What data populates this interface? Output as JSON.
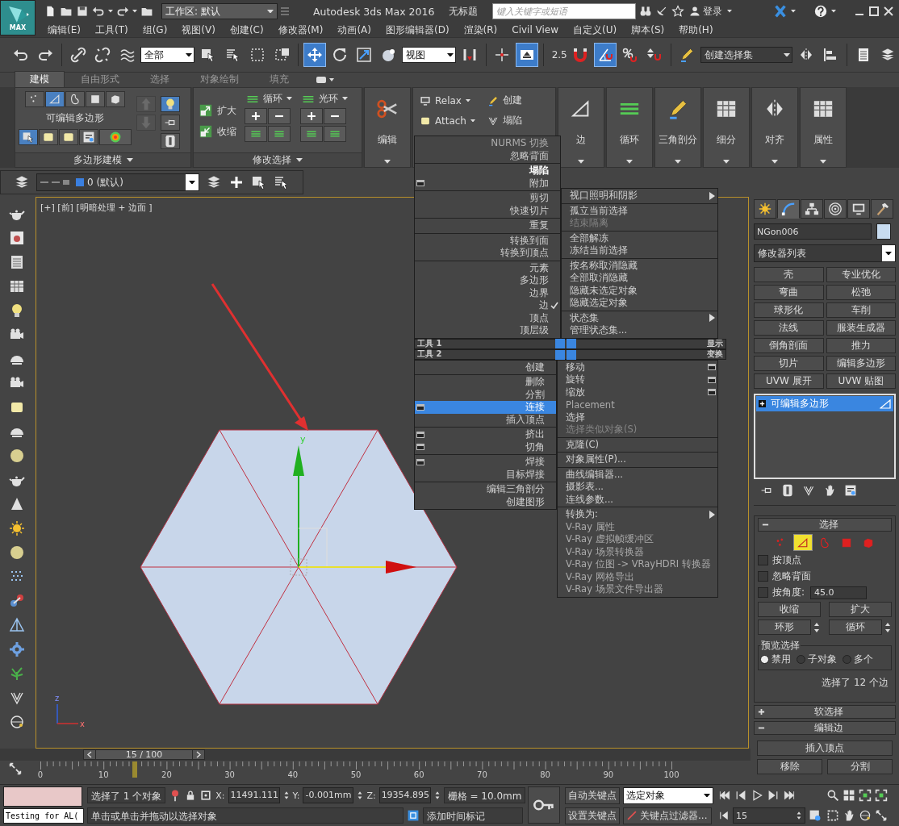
{
  "title_bar": {
    "logo": "MAX",
    "workspace": "工作区: 默认",
    "app_title": "Autodesk 3ds Max 2016",
    "document": "无标题",
    "search": {
      "placeholder": "键入关键字或短语"
    },
    "sign_in": "登录"
  },
  "menu_bar": [
    "编辑(E)",
    "工具(T)",
    "组(G)",
    "视图(V)",
    "创建(C)",
    "修改器(M)",
    "动画(A)",
    "图形编辑器(D)",
    "渲染(R)",
    "Civil View",
    "自定义(U)",
    "脚本(S)",
    "帮助(H)"
  ],
  "main_toolbar": {
    "selection_filter": "全部",
    "reference_coordinate": "视图",
    "snap_value": "2.5",
    "named_selection": "创建选择集",
    "tools": [
      {
        "selected": false
      },
      {
        "selected": false
      },
      {
        "selected": false
      },
      {
        "selected": false
      },
      {
        "selected": false
      },
      {
        "selected": false
      },
      {
        "selected": false
      },
      {
        "selected": false
      },
      {
        "selected": false
      },
      {
        "selected": true
      },
      {
        "selected": false
      },
      {
        "selected": false
      },
      {
        "selected": false
      },
      {
        "selected": false
      },
      {
        "selected": false
      },
      {
        "selected": true
      },
      {
        "selected": false
      },
      {
        "selected": true
      },
      {
        "selected": false
      },
      {
        "selected": false
      },
      {
        "selected": false
      },
      {
        "selected": false
      },
      {
        "selected": false
      },
      {
        "selected": false
      },
      {
        "selected": false
      }
    ]
  },
  "ribbon": {
    "tabs": [
      {
        "label": "建模",
        "selected": true
      },
      {
        "label": "自由形式",
        "selected": false
      },
      {
        "label": "选择",
        "selected": false
      },
      {
        "label": "对象绘制",
        "selected": false
      },
      {
        "label": "填充",
        "selected": false
      }
    ],
    "poly_modeling": {
      "title": "多边形建模",
      "object_type": "可编辑多边形",
      "levels": [
        {
          "selected": false
        },
        {
          "selected": true
        },
        {
          "selected": false
        },
        {
          "selected": false
        },
        {
          "selected": false
        }
      ]
    },
    "modify_selection": {
      "title": "修改选择",
      "grow": "扩大",
      "shrink": "收缩",
      "loop": "循环",
      "ring": "光环"
    },
    "edit": "编辑",
    "geometry": {
      "relax": "Relax",
      "attach": "Attach",
      "create": "创建",
      "collapse": "塌陷"
    },
    "big_buttons": [
      "边",
      "循环",
      "三角剖分",
      "细分",
      "对齐",
      "属性"
    ]
  },
  "layer_toolbar": {
    "layer": "0 (默认)"
  },
  "viewport": {
    "label": "[+] [前] [明暗处理 + 边面 ]",
    "gizmo_axis": "y",
    "tripod_axes": [
      "z",
      "x"
    ]
  },
  "quad_menu": {
    "top_left": {
      "groups": [
        [
          {
            "label": "NURMS 切换",
            "kind": "dim",
            "selected": false,
            "checked": false,
            "settings": false
          },
          {
            "label": "忽略背面",
            "kind": "normal",
            "selected": false,
            "checked": false,
            "settings": false
          }
        ],
        [
          {
            "label": "塌陷",
            "kind": "bright",
            "selected": false,
            "checked": false,
            "settings": false
          },
          {
            "label": "附加",
            "kind": "normal",
            "selected": false,
            "checked": false,
            "settings": true
          }
        ],
        [
          {
            "label": "剪切",
            "kind": "normal",
            "selected": false,
            "checked": false,
            "settings": false
          },
          {
            "label": "快速切片",
            "kind": "normal",
            "selected": false,
            "checked": false,
            "settings": false
          }
        ],
        [
          {
            "label": "重复",
            "kind": "normal",
            "selected": false,
            "checked": false,
            "settings": false
          }
        ],
        [
          {
            "label": "转换到面",
            "kind": "normal",
            "selected": false,
            "checked": false,
            "settings": false
          },
          {
            "label": "转换到顶点",
            "kind": "normal",
            "selected": false,
            "checked": false,
            "settings": false
          }
        ],
        [
          {
            "label": "元素",
            "kind": "normal",
            "selected": false,
            "checked": false,
            "settings": false
          },
          {
            "label": "多边形",
            "kind": "normal",
            "selected": false,
            "checked": false,
            "settings": false
          },
          {
            "label": "边界",
            "kind": "normal",
            "selected": false,
            "checked": false,
            "settings": false
          },
          {
            "label": "边",
            "kind": "normal",
            "selected": false,
            "checked": true,
            "settings": false
          },
          {
            "label": "顶点",
            "kind": "normal",
            "selected": false,
            "checked": false,
            "settings": false
          },
          {
            "label": "顶层级",
            "kind": "normal",
            "selected": false,
            "checked": false,
            "settings": false
          }
        ]
      ]
    },
    "top_right": {
      "groups": [
        [
          {
            "label": "视口照明和阴影",
            "kind": "normal",
            "selected": false,
            "settings": false,
            "submenu": true
          }
        ],
        [
          {
            "label": "孤立当前选择",
            "kind": "normal",
            "selected": false,
            "settings": false,
            "submenu": false
          },
          {
            "label": "结束隔离",
            "kind": "disabled",
            "selected": false,
            "settings": false,
            "submenu": false
          }
        ],
        [
          {
            "label": "全部解冻",
            "kind": "normal",
            "selected": false,
            "settings": false,
            "submenu": false
          },
          {
            "label": "冻结当前选择",
            "kind": "normal",
            "selected": false,
            "settings": false,
            "submenu": false
          }
        ],
        [
          {
            "label": "按名称取消隐藏",
            "kind": "normal",
            "selected": false,
            "settings": false,
            "submenu": false
          },
          {
            "label": "全部取消隐藏",
            "kind": "normal",
            "selected": false,
            "settings": false,
            "submenu": false
          },
          {
            "label": "隐藏未选定对象",
            "kind": "normal",
            "selected": false,
            "settings": false,
            "submenu": false
          },
          {
            "label": "隐藏选定对象",
            "kind": "normal",
            "selected": false,
            "settings": false,
            "submenu": false
          }
        ],
        [
          {
            "label": "状态集",
            "kind": "normal",
            "selected": false,
            "settings": false,
            "submenu": true
          },
          {
            "label": "管理状态集...",
            "kind": "normal",
            "selected": false,
            "settings": false,
            "submenu": false
          }
        ]
      ]
    },
    "headers": [
      {
        "left": "工具 1",
        "right": "显示"
      },
      {
        "left": "工具 2",
        "right": "变换"
      }
    ],
    "bottom_left": {
      "groups": [
        [
          {
            "label": "创建",
            "kind": "normal",
            "selected": false,
            "checked": false,
            "settings": false
          }
        ],
        [
          {
            "label": "删除",
            "kind": "normal",
            "selected": false,
            "checked": false,
            "settings": false
          },
          {
            "label": "分割",
            "kind": "normal",
            "selected": false,
            "checked": false,
            "settings": false
          },
          {
            "label": "连接",
            "kind": "normal",
            "selected": true,
            "checked": false,
            "settings": true
          },
          {
            "label": "插入顶点",
            "kind": "normal",
            "selected": false,
            "checked": false,
            "settings": false
          }
        ],
        [
          {
            "label": "挤出",
            "kind": "normal",
            "selected": false,
            "checked": false,
            "settings": true
          },
          {
            "label": "切角",
            "kind": "normal",
            "selected": false,
            "checked": false,
            "settings": true
          }
        ],
        [
          {
            "label": "焊接",
            "kind": "normal",
            "selected": false,
            "checked": false,
            "settings": true
          },
          {
            "label": "目标焊接",
            "kind": "normal",
            "selected": false,
            "checked": false,
            "settings": false
          }
        ],
        [
          {
            "label": "编辑三角剖分",
            "kind": "normal",
            "selected": false,
            "checked": false,
            "settings": false
          },
          {
            "label": "创建图形",
            "kind": "normal",
            "selected": false,
            "checked": false,
            "settings": false
          }
        ]
      ]
    },
    "bottom_right": {
      "groups": [
        [
          {
            "label": "移动",
            "kind": "normal",
            "selected": false,
            "settings": true,
            "submenu": false
          },
          {
            "label": "旋转",
            "kind": "normal",
            "selected": false,
            "settings": true,
            "submenu": false
          },
          {
            "label": "缩放",
            "kind": "normal",
            "selected": false,
            "settings": true,
            "submenu": false
          },
          {
            "label": "Placement",
            "kind": "dim",
            "selected": false,
            "settings": false,
            "submenu": false
          },
          {
            "label": "选择",
            "kind": "normal",
            "selected": false,
            "settings": false,
            "submenu": false
          },
          {
            "label": "选择类似对象(S)",
            "kind": "disabled",
            "selected": false,
            "settings": false,
            "submenu": false
          }
        ],
        [
          {
            "label": "克隆(C)",
            "kind": "normal",
            "selected": false,
            "settings": false,
            "submenu": false
          }
        ],
        [
          {
            "label": "对象属性(P)...",
            "kind": "normal",
            "selected": false,
            "settings": false,
            "submenu": false
          }
        ],
        [
          {
            "label": "曲线编辑器...",
            "kind": "normal",
            "selected": false,
            "settings": false,
            "submenu": false
          },
          {
            "label": "摄影表...",
            "kind": "normal",
            "selected": false,
            "settings": false,
            "submenu": false
          },
          {
            "label": "连线参数...",
            "kind": "normal",
            "selected": false,
            "settings": false,
            "submenu": false
          }
        ],
        [
          {
            "label": "转换为:",
            "kind": "normal",
            "selected": false,
            "settings": false,
            "submenu": true
          },
          {
            "label": "V-Ray 属性",
            "kind": "dim",
            "selected": false,
            "settings": false,
            "submenu": false
          },
          {
            "label": "V-Ray 虚拟帧缓冲区",
            "kind": "dim",
            "selected": false,
            "settings": false,
            "submenu": false
          },
          {
            "label": "V-Ray 场景转换器",
            "kind": "dim",
            "selected": false,
            "settings": false,
            "submenu": false
          },
          {
            "label": "V-Ray 位图 -> VRayHDRI 转换器",
            "kind": "dim",
            "selected": false,
            "settings": false,
            "submenu": false
          },
          {
            "label": "V-Ray 网格导出",
            "kind": "dim",
            "selected": false,
            "settings": false,
            "submenu": false
          },
          {
            "label": "V-Ray 场景文件导出器",
            "kind": "dim",
            "selected": false,
            "settings": false,
            "submenu": false
          }
        ]
      ]
    }
  },
  "command_panel": {
    "tabs": [
      {
        "selected": false
      },
      {
        "selected": true
      },
      {
        "selected": false
      },
      {
        "selected": false
      },
      {
        "selected": false
      },
      {
        "selected": false
      }
    ],
    "object_name": "NGon006",
    "modifier_list": "修改器列表",
    "modifier_buttons": [
      "壳",
      "专业优化",
      "弯曲",
      "松弛",
      "球形化",
      "车削",
      "法线",
      "服装生成器",
      "倒角剖面",
      "推力",
      "切片",
      "编辑多边形",
      "UVW 展开",
      "UVW 贴图"
    ],
    "stack": [
      {
        "label": "可编辑多边形",
        "selected": true
      }
    ],
    "selection_rollout": {
      "title": "选择",
      "expanded": true,
      "levels": [
        {
          "selected": false
        },
        {
          "selected": true
        },
        {
          "selected": false
        },
        {
          "selected": false
        },
        {
          "selected": false
        }
      ],
      "options": [
        {
          "label": "按顶点",
          "checked": false
        },
        {
          "label": "忽略背面",
          "checked": false
        },
        {
          "label": "按角度:",
          "checked": false
        }
      ],
      "angle_value": "45.0",
      "buttons": [
        "收缩",
        "扩大"
      ],
      "spinner_buttons": [
        "环形",
        "循环"
      ],
      "preview": {
        "title": "预览选择",
        "options": [
          {
            "label": "禁用",
            "selected": true
          },
          {
            "label": "子对象",
            "selected": false
          },
          {
            "label": "多个",
            "selected": false
          }
        ]
      },
      "status": "选择了 12 个边"
    },
    "rollouts": [
      {
        "title": "软选择",
        "expanded": false
      },
      {
        "title": "编辑边",
        "expanded": true,
        "buttons": [
          "插入顶点",
          "移除",
          "分割"
        ]
      }
    ]
  },
  "time_slider": {
    "frame": "15 / 100",
    "level": 0.15
  },
  "track_bar": {
    "ticks": [
      "0",
      "10",
      "20",
      "30",
      "40",
      "50",
      "60",
      "70",
      "80",
      "90",
      "100"
    ]
  },
  "status_bar": {
    "listener": {
      "value": "Testing for AL("
    },
    "selection": "选择了 1 个对象",
    "coords": [
      {
        "axis": "X:",
        "value": "11491.111"
      },
      {
        "axis": "Y:",
        "value": "-0.001mm"
      },
      {
        "axis": "Z:",
        "value": "19354.895"
      }
    ],
    "grid": "栅格 = 10.0mm",
    "prompt": "单击或单击并拖动以选择对象",
    "add_time_tag": "添加时间标记",
    "auto_key": "自动关键点",
    "set_key": "设置关键点",
    "key_mode": "选定对象",
    "key_filters": "关键点过滤器...",
    "frame": "15"
  }
}
